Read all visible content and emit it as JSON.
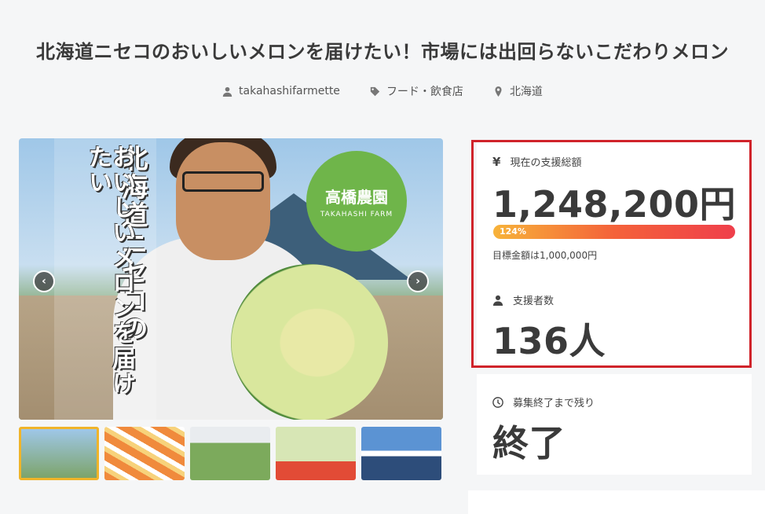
{
  "project": {
    "title": "北海道ニセコのおいしいメロンを届けたい！市場には出回らないこだわりメロン",
    "author": "takahashifarmette",
    "category": "フード・飲食店",
    "location": "北海道"
  },
  "hero": {
    "vertical_text_1": "北海道ニセコの",
    "vertical_text_2": "おいしいメロンを届けたい",
    "logo_ja": "高橋農園",
    "logo_en": "TAKAHASHI FARM",
    "prev": "‹",
    "next": "›"
  },
  "stats": {
    "amount_label": "現在の支援総額",
    "amount_icon": "yen-icon",
    "yen_glyph": "¥",
    "amount": "1,248,200円",
    "progress_percent": 124,
    "progress_text": "124%",
    "goal": "目標金額は1,000,000円",
    "supporters_label": "支援者数",
    "supporters": "136人",
    "remaining_label": "募集終了まで残り",
    "remaining": "終了"
  },
  "colors": {
    "highlight": "#d0232a",
    "progress_start": "#f7b33a",
    "progress_end": "#ef3f4b",
    "thumb_active": "#f0b429"
  }
}
